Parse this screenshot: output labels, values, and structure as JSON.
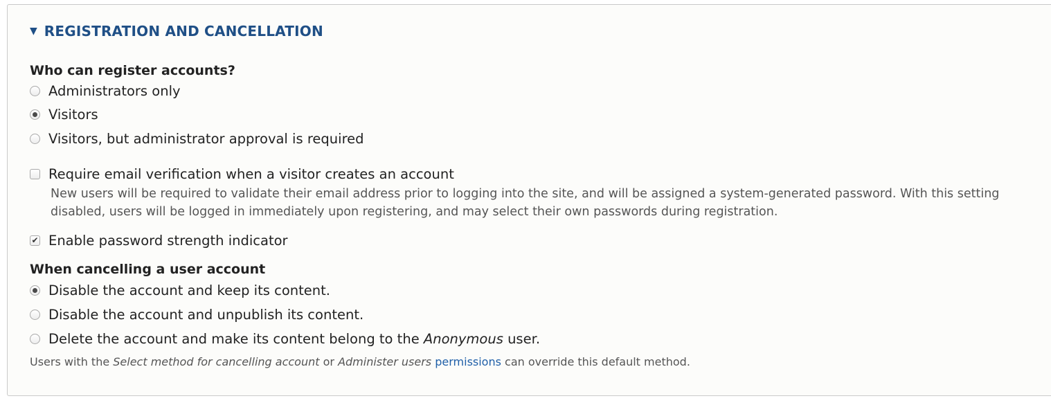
{
  "section": {
    "title": "REGISTRATION AND CANCELLATION"
  },
  "register": {
    "heading": "Who can register accounts?",
    "options": [
      {
        "label": "Administrators only",
        "checked": false
      },
      {
        "label": "Visitors",
        "checked": true
      },
      {
        "label": "Visitors, but administrator approval is required",
        "checked": false
      }
    ]
  },
  "email_verification": {
    "label": "Require email verification when a visitor creates an account",
    "checked": false,
    "description": "New users will be required to validate their email address prior to logging into the site, and will be assigned a system-generated password. With this setting disabled, users will be logged in immediately upon registering, and may select their own passwords during registration."
  },
  "password_strength": {
    "label": "Enable password strength indicator",
    "checked": true
  },
  "cancel": {
    "heading": "When cancelling a user account",
    "options": [
      {
        "label": "Disable the account and keep its content.",
        "checked": true
      },
      {
        "label": "Disable the account and unpublish its content.",
        "checked": false
      },
      {
        "label_before": "Delete the account and make its content belong to the ",
        "label_em": "Anonymous",
        "label_after": " user.",
        "checked": false
      }
    ],
    "footnote": {
      "t1": "Users with the ",
      "em1": "Select method for cancelling account",
      "t2": " or ",
      "em2": "Administer users",
      "t3": " ",
      "link": "permissions",
      "t4": " can override this default method."
    }
  }
}
